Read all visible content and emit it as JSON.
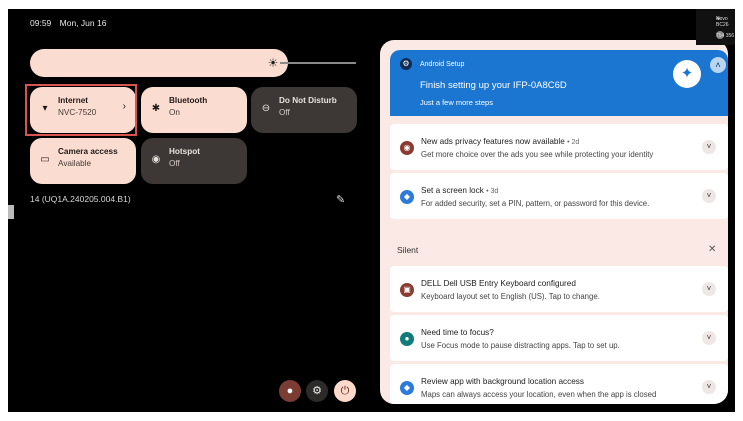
{
  "status": {
    "time": "09:59",
    "date": "Mon, Jun 16"
  },
  "brightness": {
    "icon": "brightness-icon"
  },
  "tiles": {
    "internet": {
      "title": "Internet",
      "subtitle": "NVC-7520"
    },
    "bluetooth": {
      "title": "Bluetooth",
      "subtitle": "On"
    },
    "dnd": {
      "title": "Do Not Disturb",
      "subtitle": "Off"
    },
    "camera": {
      "title": "Camera access",
      "subtitle": "Available"
    },
    "hotspot": {
      "title": "Hotspot",
      "subtitle": "Off"
    }
  },
  "build": "14 (UQ1A.240205.004.B1)",
  "setup": {
    "app": "Android Setup",
    "title": "Finish setting up your IFP-0A8C6D",
    "subtitle": "Just a few more steps"
  },
  "notifications": [
    {
      "title": "New ads privacy features now available",
      "time": "• 2d",
      "desc": "Get more choice over the ads you see while protecting your identity"
    },
    {
      "title": "Set a screen lock",
      "time": "• 3d",
      "desc": "For added security, set a PIN, pattern, or password for this device."
    }
  ],
  "silent": {
    "label": "Silent"
  },
  "silent_notifications": [
    {
      "title": "DELL Dell USB Entry Keyboard configured",
      "desc": "Keyboard layout set to English (US). Tap to change."
    },
    {
      "title": "Need time to focus?",
      "desc": "Use Focus mode to pause distracting apps. Tap to set up."
    },
    {
      "title": "Review app with background location access",
      "desc": "Maps can always access your location, even when the app is closed"
    }
  ],
  "topright": {
    "line1": "Novo BC26",
    "line2": "754 356"
  }
}
